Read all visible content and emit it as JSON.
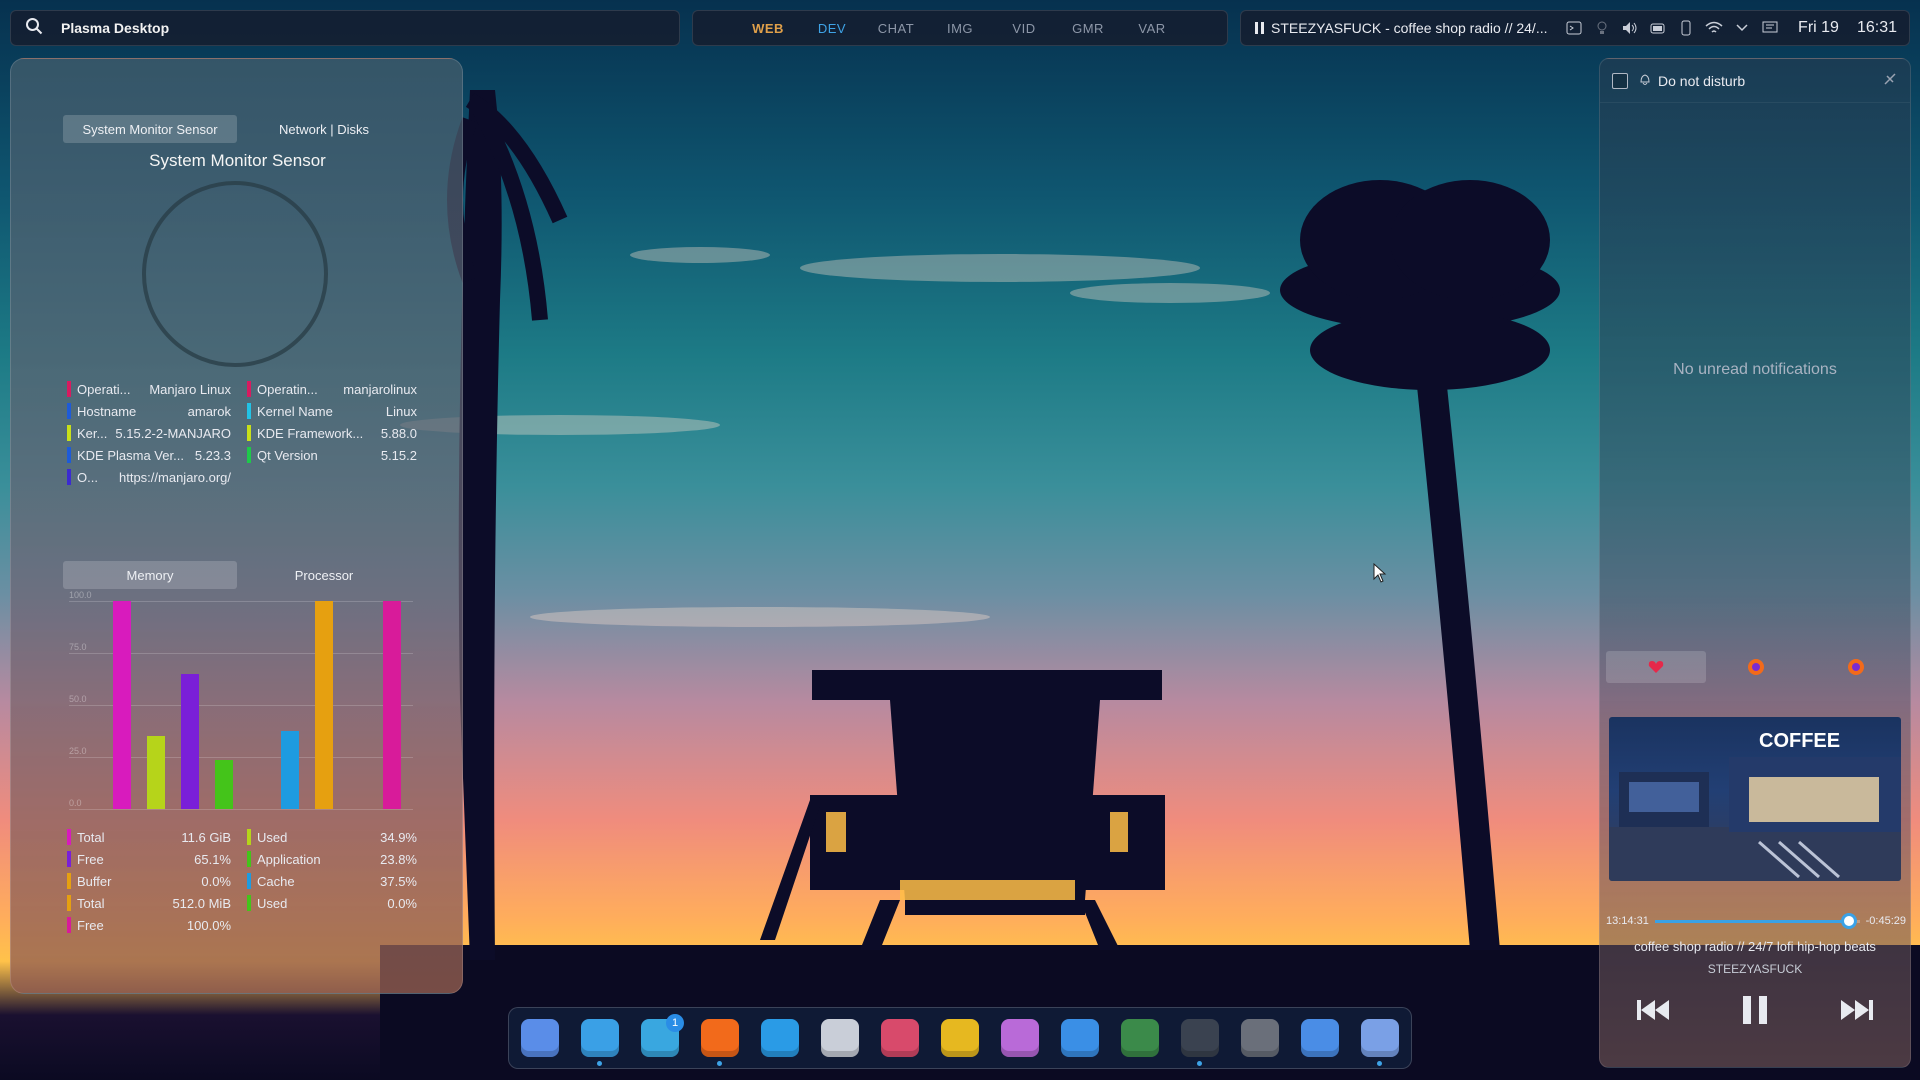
{
  "topbar": {
    "search_text": "Plasma Desktop",
    "workspaces": [
      "WEB",
      "DEV",
      "CHAT",
      "IMG",
      "VID",
      "GMR",
      "VAR"
    ],
    "now_playing": "STEEZYASFUCK - coffee shop radio // 24/...",
    "date": "Fri 19",
    "time": "16:31"
  },
  "system_monitor": {
    "tabs": [
      "System Monitor Sensor",
      "Network | Disks"
    ],
    "title": "System Monitor Sensor",
    "info_left": [
      {
        "k": "Operati...",
        "v": "Manjaro Linux",
        "color": "#d81b60"
      },
      {
        "k": "Hostname",
        "v": "amarok",
        "color": "#1e5bd8"
      },
      {
        "k": "Ker...",
        "v": "5.15.2-2-MANJARO",
        "color": "#c8e01a"
      },
      {
        "k": "KDE Plasma Ver...",
        "v": "5.23.3",
        "color": "#1e5bd8"
      },
      {
        "k": "O...",
        "v": "https://manjaro.org/",
        "color": "#3b2bd1"
      }
    ],
    "info_right": [
      {
        "k": "Operatin...",
        "v": "manjarolinux",
        "color": "#d81b60"
      },
      {
        "k": "Kernel Name",
        "v": "Linux",
        "color": "#22c3e6"
      },
      {
        "k": "KDE Framework...",
        "v": "5.88.0",
        "color": "#c8e01a"
      },
      {
        "k": "Qt Version",
        "v": "5.15.2",
        "color": "#1ec94a"
      }
    ]
  },
  "memory": {
    "tabs": [
      "Memory",
      "Processor"
    ],
    "y_ticks": [
      "100.0",
      "75.0",
      "50.0",
      "25.0",
      "0.0"
    ],
    "bars": [
      {
        "value": 100,
        "color": "#d81bbd"
      },
      {
        "value": 35,
        "color": "#b6d41a"
      },
      {
        "value": 65,
        "color": "#7a1fd8"
      },
      {
        "value": 23.8,
        "color": "#44c41a"
      },
      {
        "value": 37.5,
        "color": "#1e9be0"
      },
      {
        "value": 100,
        "color": "#e6a010"
      },
      {
        "value": 100,
        "color": "#d81b9a"
      }
    ],
    "stats_left": [
      {
        "k": "Total",
        "v": "11.6 GiB",
        "color": "#d81bbd"
      },
      {
        "k": "Free",
        "v": "65.1%",
        "color": "#7a1fd8"
      },
      {
        "k": "Buffer",
        "v": "0.0%",
        "color": "#e6a010"
      },
      {
        "k": "Total",
        "v": "512.0 MiB",
        "color": "#e6a010"
      },
      {
        "k": "Free",
        "v": "100.0%",
        "color": "#d81b9a"
      }
    ],
    "stats_right": [
      {
        "k": "Used",
        "v": "34.9%",
        "color": "#b6d41a"
      },
      {
        "k": "Application",
        "v": "23.8%",
        "color": "#44c41a"
      },
      {
        "k": "Cache",
        "v": "37.5%",
        "color": "#1e9be0"
      },
      {
        "k": "Used",
        "v": "0.0%",
        "color": "#44c41a"
      }
    ]
  },
  "notifications": {
    "dnd_label": "Do not disturb",
    "empty_text": "No unread notifications",
    "media": {
      "elapsed": "13:14:31",
      "remaining": "-0:45:29",
      "progress": 0.95,
      "title": "coffee shop radio // 24/7 lofi hip-hop beats",
      "artist": "STEEZYASFUCK",
      "art_text": "COFFEE"
    }
  },
  "dock": {
    "icons": [
      {
        "name": "discover-icon",
        "color": "#5a8de8",
        "running": false
      },
      {
        "name": "file-manager-icon",
        "color": "#3aa0e6",
        "running": true
      },
      {
        "name": "telegram-icon",
        "color": "#39a7e0",
        "running": false,
        "badge": "1"
      },
      {
        "name": "firefox-icon",
        "color": "#f26a1b",
        "running": true
      },
      {
        "name": "vscodium-icon",
        "color": "#2a9be6",
        "running": false
      },
      {
        "name": "text-editor-icon",
        "color": "#c9ced8",
        "running": false
      },
      {
        "name": "krita-icon",
        "color": "#d84a6b",
        "running": false
      },
      {
        "name": "color-picker-icon",
        "color": "#e6b820",
        "running": false
      },
      {
        "name": "screenshot-icon",
        "color": "#b96ad8",
        "running": false
      },
      {
        "name": "document-viewer-icon",
        "color": "#3a8fe6",
        "running": false
      },
      {
        "name": "image-viewer-icon",
        "color": "#3b8a4a",
        "running": false
      },
      {
        "name": "terminal-icon",
        "color": "#3a4250",
        "running": true
      },
      {
        "name": "settings-icon",
        "color": "#6a6f7a",
        "running": false
      },
      {
        "name": "virtual-desktops-icon",
        "color": "#4a8de6",
        "running": false
      },
      {
        "name": "kde-connect-icon",
        "color": "#7aa0e6",
        "running": true
      }
    ]
  }
}
